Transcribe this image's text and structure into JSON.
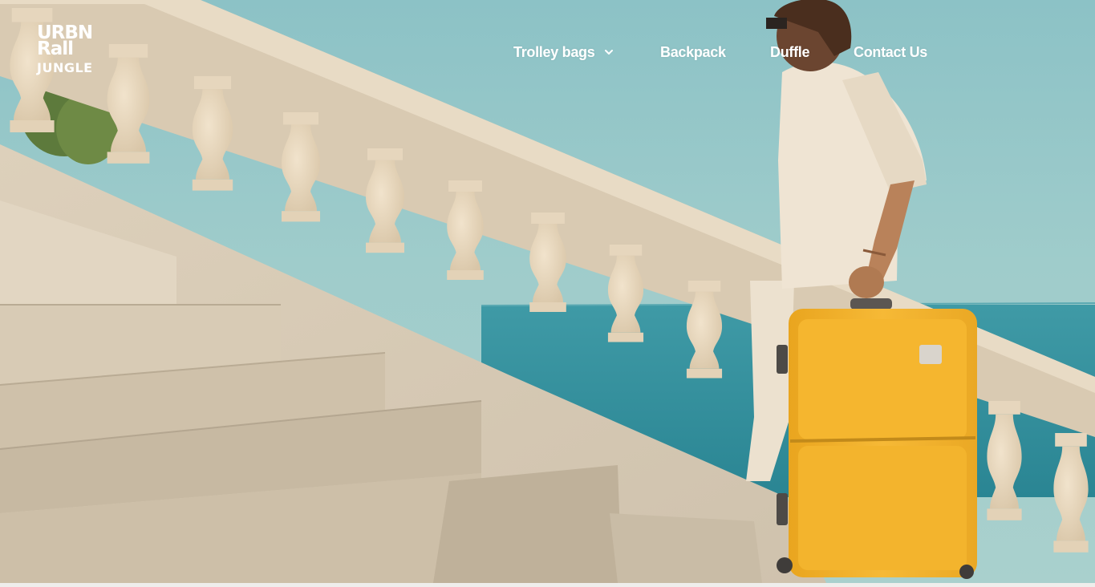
{
  "brand": {
    "logo_line1": "URBN",
    "logo_line2": "Rall",
    "logo_line3": "JUNGLE"
  },
  "nav": {
    "items": [
      {
        "label": "Trolley bags",
        "has_dropdown": true
      },
      {
        "label": "Backpack",
        "has_dropdown": false
      },
      {
        "label": "Duffle",
        "has_dropdown": false
      },
      {
        "label": "Contact Us",
        "has_dropdown": false
      }
    ]
  },
  "icons": {
    "dropdown": "chevron-down-icon"
  },
  "colors": {
    "nav_text": "#ffffff",
    "sky": "#8cc2c6",
    "sea": "#2f8f9a",
    "stone": "#e2d4bd",
    "suitcase": "#f2b12c"
  }
}
